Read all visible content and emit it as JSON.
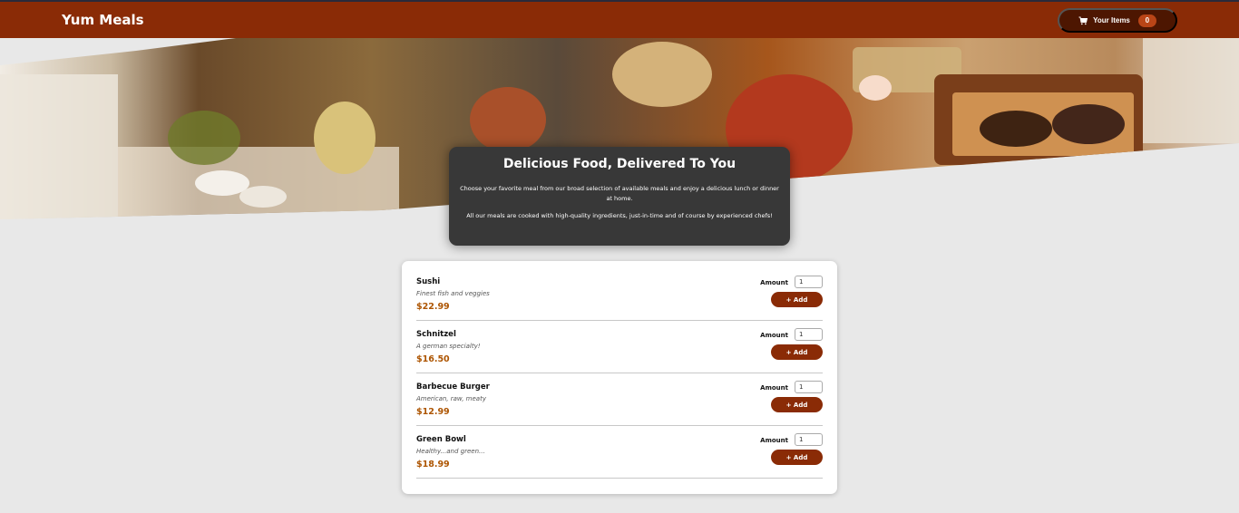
{
  "header": {
    "title": "Yum Meals",
    "cart_label": "Your Items",
    "cart_count": "0"
  },
  "intro": {
    "heading": "Delicious Food, Delivered To You",
    "paragraph1": "Choose your favorite meal from our broad selection of available meals and enjoy a delicious lunch or dinner at home.",
    "paragraph2": "All our meals are cooked with high-quality ingredients, just-in-time and of course by experienced chefs!"
  },
  "meals": [
    {
      "name": "Sushi",
      "description": "Finest fish and veggies",
      "price": "$22.99",
      "amount_label": "Amount",
      "amount": "1",
      "add_label": "+ Add"
    },
    {
      "name": "Schnitzel",
      "description": "A german specialty!",
      "price": "$16.50",
      "amount_label": "Amount",
      "amount": "1",
      "add_label": "+ Add"
    },
    {
      "name": "Barbecue Burger",
      "description": "American, raw, meaty",
      "price": "$12.99",
      "amount_label": "Amount",
      "amount": "1",
      "add_label": "+ Add"
    },
    {
      "name": "Green Bowl",
      "description": "Healthy...and green...",
      "price": "$18.99",
      "amount_label": "Amount",
      "amount": "1",
      "add_label": "+ Add"
    }
  ],
  "colors": {
    "header": "#8a2b06",
    "cart_button": "#4d1601",
    "badge": "#b94517",
    "price": "#ad5502",
    "intro_card": "#383838",
    "background": "#e8e8e8"
  },
  "icons": {
    "cart": "shopping-cart-icon"
  }
}
